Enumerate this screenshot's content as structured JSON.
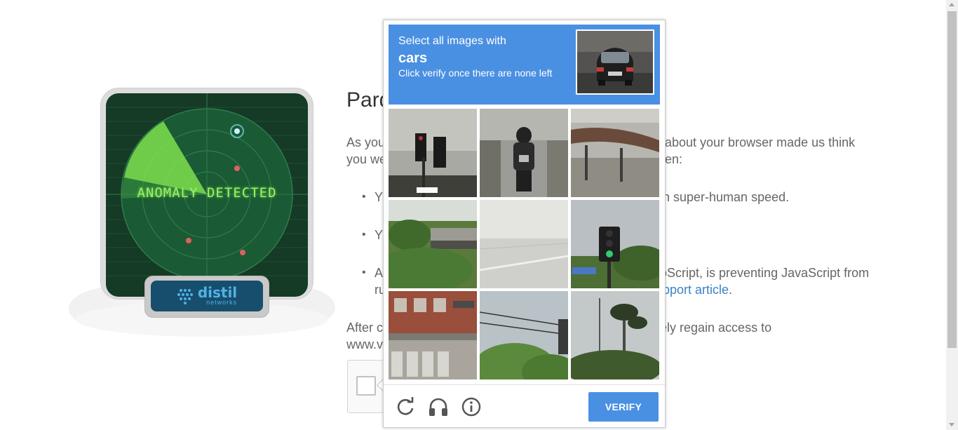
{
  "background_page": {
    "title": "Pard",
    "intro_left": "As you",
    "intro_right": "about your browser made us think",
    "intro_left_2": "you we",
    "intro_right_2": "en:",
    "bullets": [
      {
        "left": "Y",
        "right": "h super-human speed."
      },
      {
        "left": "Y",
        "right": ""
      },
      {
        "left": "A",
        "right": "oScript, is preventing JavaScript from",
        "left_2": "ru",
        "link_text": "pport article",
        "after_link": "."
      }
    ],
    "after_left": "After c",
    "after_right": "ely regain access to",
    "after_left_2": "www.v",
    "radar_text": "ANOMALY DETECTED",
    "distil_brand": "distil",
    "distil_sub": "networks"
  },
  "recaptcha": {
    "instruction_line1": "Select all images with",
    "keyword": "cars",
    "instruction_line2": "Click verify once there are none left",
    "tiles": [
      {
        "label": "traffic-light-tile"
      },
      {
        "label": "motorcycle-tile"
      },
      {
        "label": "bridge-roof-tile"
      },
      {
        "label": "overpass-tile"
      },
      {
        "label": "road-blank-tile"
      },
      {
        "label": "traffic-light-tile-2"
      },
      {
        "label": "crosswalk-building-tile"
      },
      {
        "label": "power-lines-trees-tile"
      },
      {
        "label": "palm-trees-tile"
      }
    ],
    "verify_label": "VERIFY",
    "icons": {
      "reload": "reload-icon",
      "audio": "headphones-icon",
      "info": "info-icon"
    }
  },
  "colors": {
    "accent_blue": "#4a90e2",
    "link_blue": "#3b83c7",
    "radar_green": "#7ee04f"
  }
}
